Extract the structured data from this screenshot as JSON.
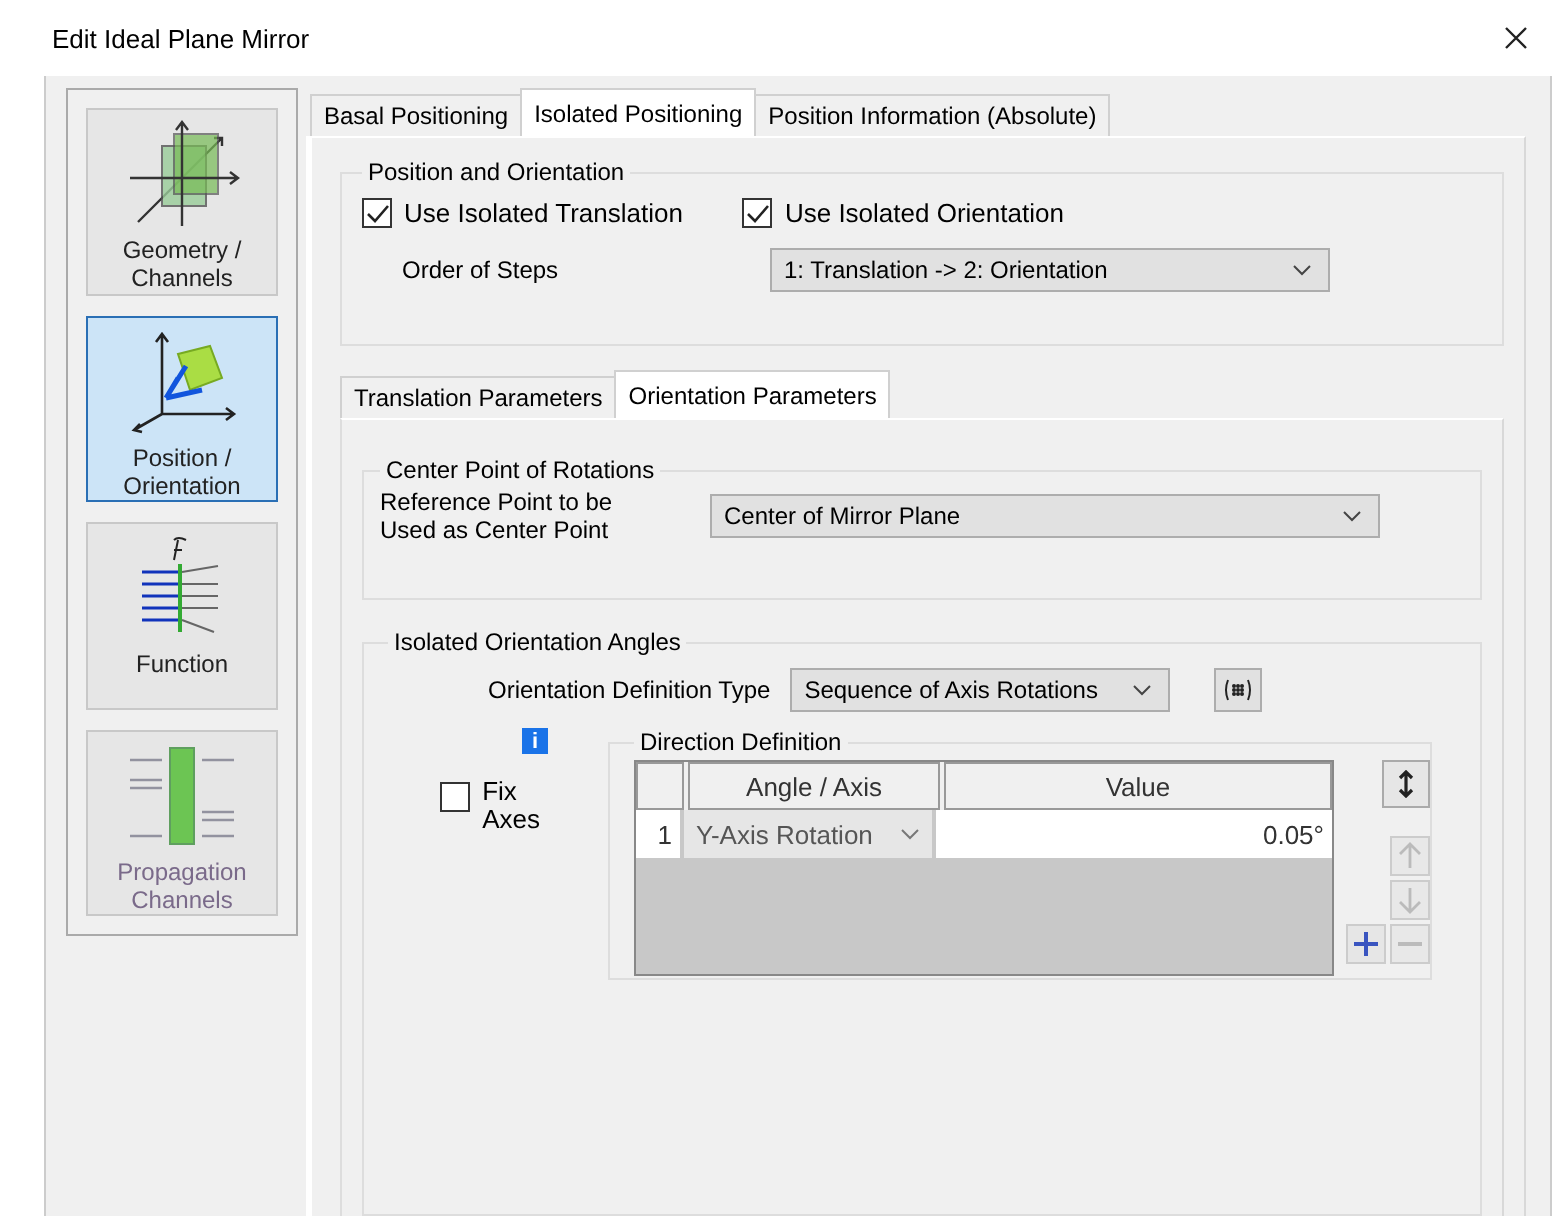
{
  "window": {
    "title": "Edit Ideal Plane Mirror"
  },
  "sidebar": {
    "items": [
      {
        "label": "Geometry / Channels",
        "kind": "geometry",
        "selected": false,
        "disabled": false
      },
      {
        "label": "Position / Orientation",
        "kind": "position",
        "selected": true,
        "disabled": false
      },
      {
        "label": "Function",
        "kind": "function",
        "selected": false,
        "disabled": false
      },
      {
        "label": "Propagation Channels",
        "kind": "propagation",
        "selected": false,
        "disabled": true
      }
    ]
  },
  "tabs": [
    {
      "label": "Basal Positioning",
      "selected": false
    },
    {
      "label": "Isolated Positioning",
      "selected": true
    },
    {
      "label": "Position Information (Absolute)",
      "selected": false
    }
  ],
  "position_and_orientation": {
    "title": "Position and Orientation",
    "checkboxes": [
      {
        "label": "Use Isolated Translation",
        "checked": true
      },
      {
        "label": "Use Isolated Orientation",
        "checked": true
      }
    ],
    "order_label": "Order of Steps",
    "order_value": "1: Translation -> 2: Orientation"
  },
  "subtabs": [
    {
      "label": "Translation Parameters",
      "selected": false
    },
    {
      "label": "Orientation Parameters",
      "selected": true
    }
  ],
  "center_point": {
    "title": "Center Point of Rotations",
    "label": "Reference Point to be\nUsed as Center Point",
    "value": "Center of Mirror Plane"
  },
  "orientation_angles": {
    "title": "Isolated Orientation Angles",
    "type_label": "Orientation Definition Type",
    "type_value": "Sequence of Axis Rotations",
    "info": "i",
    "fix_axes": {
      "label": "Fix\nAxes",
      "checked": false
    },
    "direction": {
      "title": "Direction Definition",
      "columns": [
        "Angle / Axis",
        "Value"
      ],
      "rows": [
        {
          "index": "1",
          "angle": "Y-Axis Rotation",
          "value": "0.05°"
        }
      ],
      "buttons": [
        {
          "kind": "swap",
          "disabled": false
        },
        {
          "kind": "up",
          "disabled": true
        },
        {
          "kind": "down",
          "disabled": true
        },
        {
          "kind": "add",
          "disabled": false
        },
        {
          "kind": "remove",
          "disabled": true
        }
      ]
    }
  }
}
